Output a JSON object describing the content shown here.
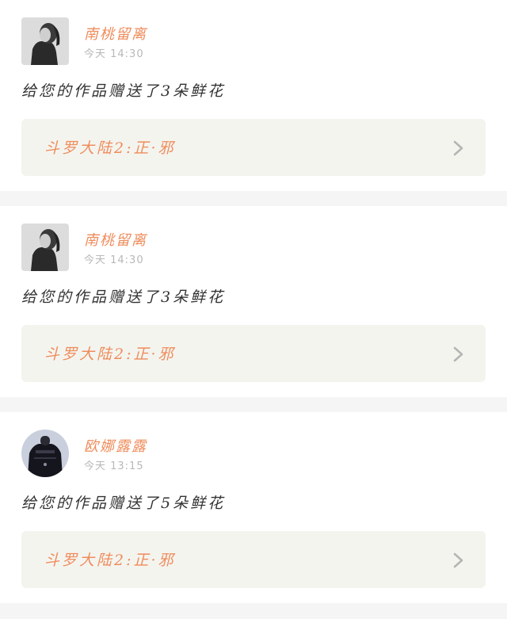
{
  "notifications": [
    {
      "username": "南桃留离",
      "time": "今天 14:30",
      "message": "给您的作品赠送了3朵鲜花",
      "work_title": "斗罗大陆2:正·邪",
      "avatar_icon": "user-photo-grayscale"
    },
    {
      "username": "南桃留离",
      "time": "今天 14:30",
      "message": "给您的作品赠送了3朵鲜花",
      "work_title": "斗罗大陆2:正·邪",
      "avatar_icon": "user-photo-grayscale"
    },
    {
      "username": "欧娜露露",
      "time": "今天 13:15",
      "message": "给您的作品赠送了5朵鲜花",
      "work_title": "斗罗大陆2:正·邪",
      "avatar_icon": "user-photo-round"
    }
  ],
  "colors": {
    "accent": "#ef8c5b",
    "link_bg": "#f4f4ef",
    "separator": "#f5f5f5",
    "time_text": "#b8b8b8"
  }
}
